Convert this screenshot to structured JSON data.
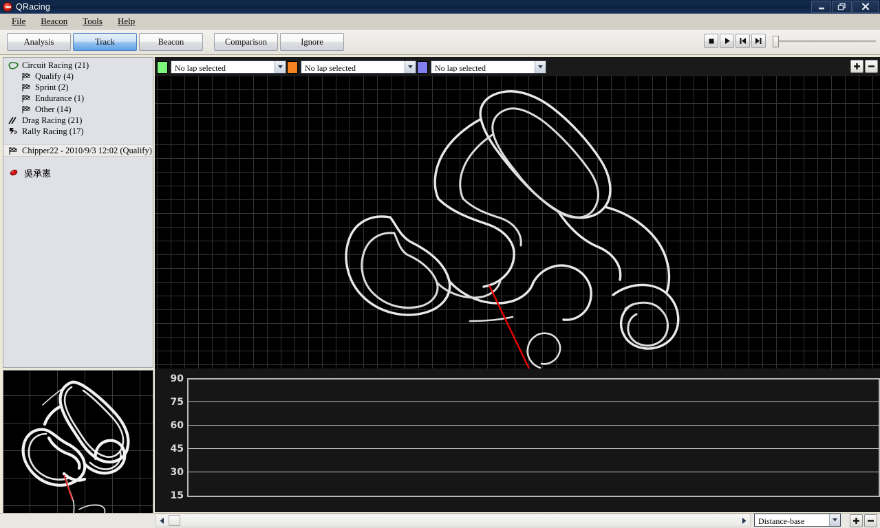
{
  "window": {
    "title": "QRacing",
    "app_icon": "qracing-logo-icon",
    "minimize_label": "Minimize",
    "restore_label": "Restore",
    "close_label": "Close"
  },
  "menu": {
    "items": [
      {
        "label": "File",
        "mnemonic": "F"
      },
      {
        "label": "Beacon",
        "mnemonic": "B"
      },
      {
        "label": "Tools",
        "mnemonic": "T"
      },
      {
        "label": "Help",
        "mnemonic": "H"
      }
    ]
  },
  "tabs": [
    {
      "label": "Analysis",
      "active": false
    },
    {
      "label": "Track",
      "active": true
    },
    {
      "label": "Beacon",
      "active": false
    },
    {
      "label": "Comparison",
      "active": false
    },
    {
      "label": "Ignore",
      "active": false
    }
  ],
  "media_controls": {
    "stop_label": "Stop",
    "play_label": "Play",
    "prev_label": "Skip to start",
    "next_label": "Skip to end",
    "slider_value": 0
  },
  "sidebar": {
    "tree": [
      {
        "label": "Circuit Racing (21)",
        "icon": "circuit-track-icon",
        "level": 0
      },
      {
        "label": "Qualify (4)",
        "icon": "checkered-flag-icon",
        "level": 1
      },
      {
        "label": "Sprint (2)",
        "icon": "checkered-flag-icon",
        "level": 1
      },
      {
        "label": "Endurance (1)",
        "icon": "checkered-flag-icon",
        "level": 1
      },
      {
        "label": "Other (14)",
        "icon": "checkered-flag-icon",
        "level": 1
      },
      {
        "label": "Drag Racing (21)",
        "icon": "drag-strip-icon",
        "level": 0
      },
      {
        "label": "Rally Racing (17)",
        "icon": "rally-car-icon",
        "level": 0
      }
    ],
    "selected_session": {
      "label": "Chipper22 - 2010/9/3 12:02 (Qualify)",
      "icon": "checkered-flag-icon"
    },
    "driver": {
      "name": "吳承憲",
      "icon": "driver-helmet-icon"
    }
  },
  "lap_selectors": [
    {
      "color": "#7cf77c",
      "value": "No lap selected",
      "placeholder": "No lap selected"
    },
    {
      "color": "#f58220",
      "value": "No lap selected",
      "placeholder": "No lap selected"
    },
    {
      "color": "#8080f0",
      "value": "No lap selected",
      "placeholder": "No lap selected"
    }
  ],
  "track_panel": {
    "zoom_in_label": "+",
    "zoom_out_label": "−",
    "background_color": "#000000",
    "track_line_color": "#e8e8e8",
    "start_finish_color": "#ee0000",
    "grid_color": "#343434"
  },
  "thumbnail_panel": {
    "background_color": "#000000",
    "track_line_color": "#ffffff",
    "start_finish_color": "#dd2222"
  },
  "chart": {
    "zoom_in_label": "+",
    "zoom_out_label": "−"
  },
  "chart_data": {
    "type": "line",
    "title": "",
    "xlabel": "",
    "ylabel": "",
    "yticks": [
      90,
      75,
      60,
      45,
      30,
      15
    ],
    "ylim": [
      15,
      90
    ],
    "grid": true,
    "series": [],
    "x": [],
    "note": "empty plot - no lap data loaded"
  },
  "status_bar": {
    "mode_value": "Distance-base",
    "mode_placeholder": "Distance-base",
    "scroll_left_label": "Scroll left",
    "scroll_right_label": "Scroll right",
    "zoom_in_label": "+",
    "zoom_out_label": "−"
  }
}
